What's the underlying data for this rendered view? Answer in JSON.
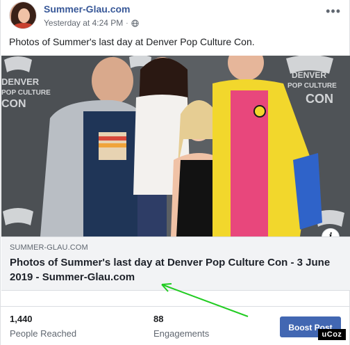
{
  "post": {
    "page_name": "Summer-Glau.com",
    "timestamp": "Yesterday at 4:24 PM",
    "privacy_icon": "globe-icon",
    "more_icon": "more-dots-icon",
    "text": "Photos of Summer's last day at Denver Pop Culture Con."
  },
  "photo": {
    "backdrop_logo_lines": [
      "DENVER",
      "POP CULTURE",
      "CON"
    ],
    "info_label": "i"
  },
  "link_preview": {
    "domain": "SUMMER-GLAU.COM",
    "title": "Photos of Summer's last day at Denver Pop Culture Con - 3 June 2019 - Summer-Glau.com"
  },
  "stats": {
    "reached_value": "1,440",
    "reached_label": "People Reached",
    "engagements_value": "88",
    "engagements_label": "Engagements",
    "boost_label": "Boost Post"
  },
  "annotation": {
    "arrow_color": "#22cc22"
  },
  "watermark": {
    "text": "uCoz"
  },
  "colors": {
    "page_link": "#385898",
    "boost_button": "#4267b2",
    "link_box_bg": "#f2f3f5"
  }
}
